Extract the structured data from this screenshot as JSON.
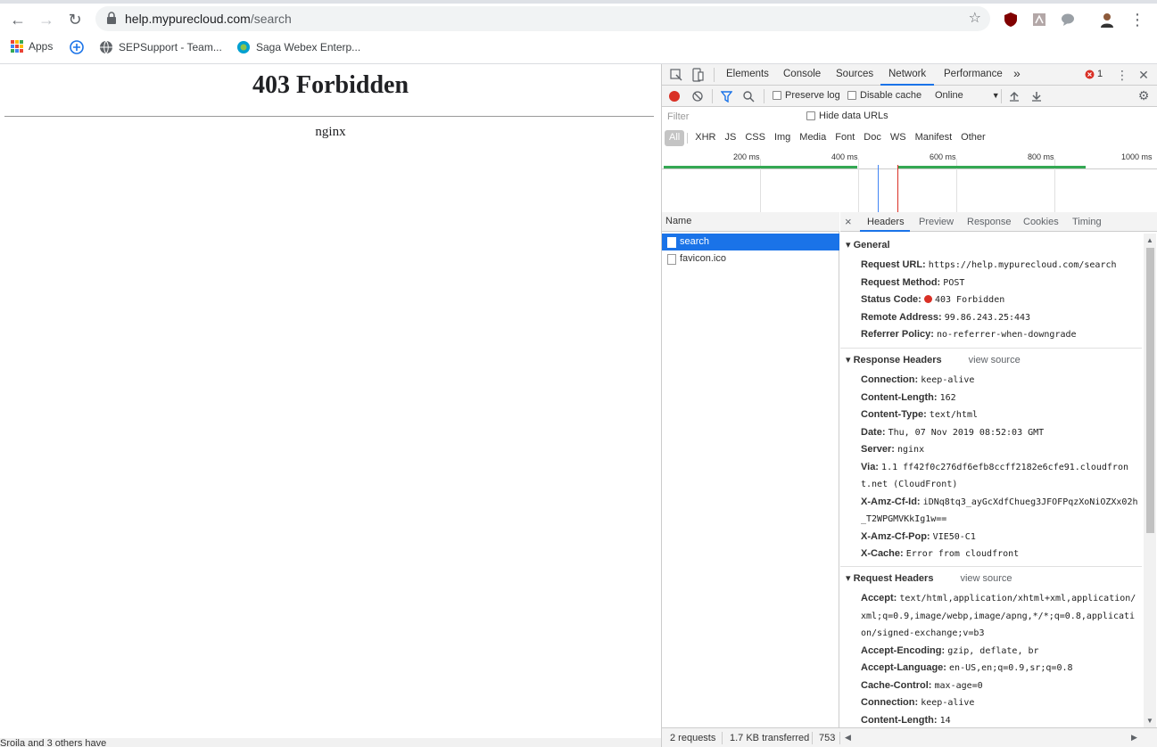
{
  "browser": {
    "url_host": "help.mypurecloud.com",
    "url_path": "/search",
    "bookmarks": [
      {
        "label": "Apps"
      },
      {
        "label": ""
      },
      {
        "label": "SEPSupport - Team..."
      },
      {
        "label": "Saga Webex Enterp..."
      }
    ]
  },
  "page": {
    "title": "403 Forbidden",
    "server": "nginx",
    "footer_text": "Sroila and 3 others have"
  },
  "devtools": {
    "tabs": [
      "Elements",
      "Console",
      "Sources",
      "Network",
      "Performance"
    ],
    "active_tab": "Network",
    "more_tabs": "»",
    "error_count": "1",
    "toolbar": {
      "preserve_log": "Preserve log",
      "disable_cache": "Disable cache",
      "throttle": "Online"
    },
    "filter_placeholder": "Filter",
    "hide_data_urls": "Hide data URLs",
    "types": [
      "All",
      "XHR",
      "JS",
      "CSS",
      "Img",
      "Media",
      "Font",
      "Doc",
      "WS",
      "Manifest",
      "Other"
    ],
    "timeline_labels": [
      "200 ms",
      "400 ms",
      "600 ms",
      "800 ms",
      "1000 ms"
    ],
    "name_header": "Name",
    "requests": [
      {
        "name": "search",
        "selected": true
      },
      {
        "name": "favicon.ico",
        "selected": false
      }
    ],
    "detail_tabs": [
      "Headers",
      "Preview",
      "Response",
      "Cookies",
      "Timing"
    ],
    "general": {
      "title": "General",
      "request_url_k": "Request URL:",
      "request_url_v": "https://help.mypurecloud.com/search",
      "method_k": "Request Method:",
      "method_v": "POST",
      "status_k": "Status Code:",
      "status_v": "403 Forbidden",
      "remote_k": "Remote Address:",
      "remote_v": "99.86.243.25:443",
      "referrer_k": "Referrer Policy:",
      "referrer_v": "no-referrer-when-downgrade"
    },
    "response_headers": {
      "title": "Response Headers",
      "view_source": "view source",
      "items": [
        {
          "k": "Connection:",
          "v": "keep-alive"
        },
        {
          "k": "Content-Length:",
          "v": "162"
        },
        {
          "k": "Content-Type:",
          "v": "text/html"
        },
        {
          "k": "Date:",
          "v": "Thu, 07 Nov 2019 08:52:03 GMT"
        },
        {
          "k": "Server:",
          "v": "nginx"
        },
        {
          "k": "Via:",
          "v": "1.1 ff42f0c276df6efb8ccff2182e6cfe91.cloudfront.net (CloudFront)"
        },
        {
          "k": "X-Amz-Cf-Id:",
          "v": "iDNq8tq3_ayGcXdfChueg3JFOFPqzXoNiOZXx02h_T2WPGMVKkIg1w=="
        },
        {
          "k": "X-Amz-Cf-Pop:",
          "v": "VIE50-C1"
        },
        {
          "k": "X-Cache:",
          "v": "Error from cloudfront"
        }
      ]
    },
    "request_headers": {
      "title": "Request Headers",
      "view_source": "view source",
      "items": [
        {
          "k": "Accept:",
          "v": "text/html,application/xhtml+xml,application/xml;q=0.9,image/webp,image/apng,*/*;q=0.8,application/signed-exchange;v=b3"
        },
        {
          "k": "Accept-Encoding:",
          "v": "gzip, deflate, br"
        },
        {
          "k": "Accept-Language:",
          "v": "en-US,en;q=0.9,sr;q=0.8"
        },
        {
          "k": "Cache-Control:",
          "v": "max-age=0"
        },
        {
          "k": "Connection:",
          "v": "keep-alive"
        },
        {
          "k": "Content-Length:",
          "v": "14"
        }
      ]
    },
    "status": {
      "requests": "2 requests",
      "transferred": "1.7 KB transferred",
      "extra": "753"
    }
  },
  "colors": {
    "accent": "#1a73e8",
    "record": "#d93025",
    "error": "#d93025",
    "timeline_green": "#34a853"
  }
}
